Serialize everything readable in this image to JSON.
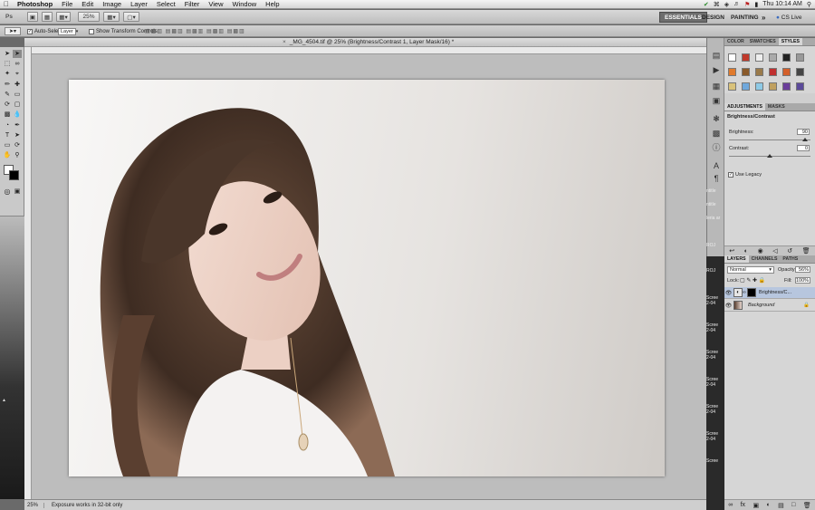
{
  "menubar": {
    "apple": "",
    "app": "Photoshop",
    "items": [
      "File",
      "Edit",
      "Image",
      "Layer",
      "Select",
      "Filter",
      "View",
      "Window",
      "Help"
    ],
    "clock": "Thu 10:14 AM",
    "spotlight_icon": "magnifier-icon"
  },
  "appbar": {
    "zoom": "25%",
    "workspaces": [
      "ESSENTIALS",
      "DESIGN",
      "PAINTING"
    ],
    "more": "»",
    "cslive": "CS Live"
  },
  "options": {
    "auto_select": "Auto-Select:",
    "auto_select_value": "Layer",
    "show_transform": "Show Transform Controls"
  },
  "document": {
    "tab_title": "_MG_4504.tif @ 25% (Brightness/Contrast 1, Layer Mask/16) *",
    "close_icon": "x-icon"
  },
  "status": {
    "zoom": "25%",
    "message": "Exposure works in 32-bit only"
  },
  "panels": {
    "top_tabs": [
      "COLOR",
      "SWATCHES",
      "STYLES"
    ],
    "adjustments_tabs": [
      "ADJUSTMENTS",
      "MASKS"
    ],
    "adjustment_title": "Brightness/Contrast",
    "brightness_label": "Brightness:",
    "brightness_value": "90",
    "contrast_label": "Contrast:",
    "contrast_value": "0",
    "use_legacy": "Use Legacy",
    "layers_tabs": [
      "LAYERS",
      "CHANNELS",
      "PATHS"
    ],
    "blend_mode": "Normal",
    "opacity_label": "Opacity:",
    "opacity_value": "56%",
    "lock_label": "Lock:",
    "fill_label": "Fill:",
    "fill_value": "100%",
    "layers": [
      {
        "name": "Brightness/C..."
      },
      {
        "name": "Background"
      }
    ]
  },
  "desktop_labels": [
    "ntitle",
    "leria ar",
    "ROJ",
    "ROJ",
    "Scree",
    "2-04",
    "Scree",
    "2-04",
    "Scree",
    "2-04",
    "Scree",
    "2-04",
    "Scree",
    "2-04",
    "Scree",
    "2-04",
    "Scree"
  ]
}
